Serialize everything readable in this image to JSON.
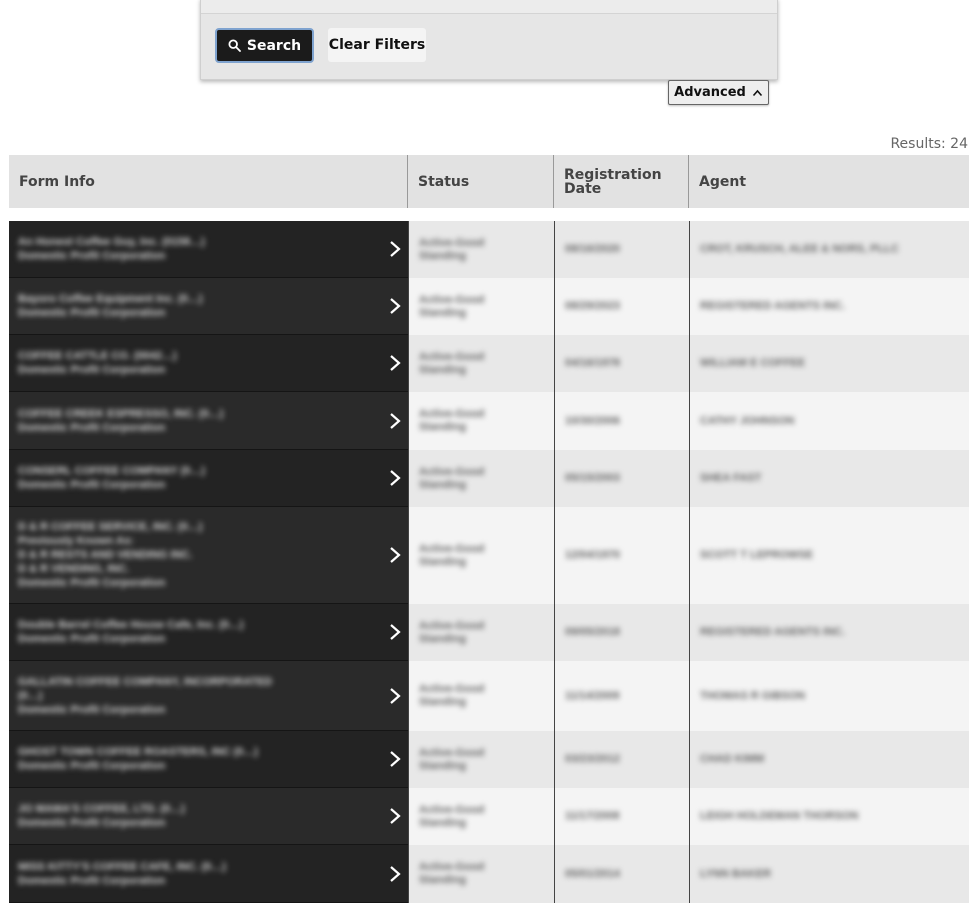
{
  "filters": {
    "search_label": "Search",
    "clear_label": "Clear Filters",
    "advanced_label": "Advanced"
  },
  "results_label": "Results: 24",
  "table": {
    "headers": {
      "form_info": "Form Info",
      "status": "Status",
      "registration_date": "Registration Date",
      "agent": "Agent"
    },
    "rows": [
      {
        "lines": [
          "An Honest Coffee Guy, Inc. (0158…)",
          "Domestic Profit Corporation"
        ],
        "status": "Active-Good Standing",
        "date": "08/16/2020",
        "agent": "CROT, KRUSCH, ALEE & NORS, PLLC"
      },
      {
        "lines": [
          "Bayoro Coffee Equipment Inc. (0…)",
          "Domestic Profit Corporation"
        ],
        "status": "Active-Good Standing",
        "date": "08/29/2023",
        "agent": "REGISTERED AGENTS INC."
      },
      {
        "lines": [
          "COFFEE CATTLE CO. (0042…)",
          "Domestic Profit Corporation"
        ],
        "status": "Active-Good Standing",
        "date": "04/16/1978",
        "agent": "WILLIAM E COFFEE"
      },
      {
        "lines": [
          "COFFEE CREEK ESPRESSO, INC. (0…)",
          "Domestic Profit Corporation"
        ],
        "status": "Active-Good Standing",
        "date": "10/30/2006",
        "agent": "CATHY JOHNSON"
      },
      {
        "lines": [
          "CONSERL COFFEE COMPANY (0…)",
          "Domestic Profit Corporation"
        ],
        "status": "Active-Good Standing",
        "date": "05/15/2003",
        "agent": "SHEA FAST"
      },
      {
        "lines": [
          "D & R COFFEE SERVICE, INC. (0…)",
          "Previously Known As:",
          "D & R RESTS AND VENDING INC.",
          "D & R VENDING, INC.",
          "Domestic Profit Corporation"
        ],
        "status": "Active-Good Standing",
        "date": "12/04/1970",
        "agent": "SCOTT T LEPROWSE"
      },
      {
        "lines": [
          "Double Barrel Coffee House Cafe, Inc. (0…)",
          "Domestic Profit Corporation"
        ],
        "status": "Active-Good Standing",
        "date": "09/05/2018",
        "agent": "REGISTERED AGENTS INC."
      },
      {
        "lines": [
          "GALLATIN COFFEE COMPANY, INCORPORATED",
          "(0…)",
          "Domestic Profit Corporation"
        ],
        "status": "Active-Good Standing",
        "date": "11/14/2009",
        "agent": "THOMAS R GIBSON"
      },
      {
        "lines": [
          "GHOST TOWN COFFEE ROASTERS, INC (0…)",
          "Domestic Profit Corporation"
        ],
        "status": "Active-Good Standing",
        "date": "03/23/2012",
        "agent": "CHAD KIMM"
      },
      {
        "lines": [
          "JO MAMA'S COFFEE, LTD. (0…)",
          "Domestic Profit Corporation"
        ],
        "status": "Active-Good Standing",
        "date": "11/17/2008",
        "agent": "LEIGH HOLDEMAN THORSON"
      },
      {
        "lines": [
          "MISS KITTY'S COFFEE CAFE, INC. (0…)",
          "Domestic Profit Corporation"
        ],
        "status": "Active-Good Standing",
        "date": "05/01/2014",
        "agent": "LYNN BAKER"
      }
    ]
  }
}
